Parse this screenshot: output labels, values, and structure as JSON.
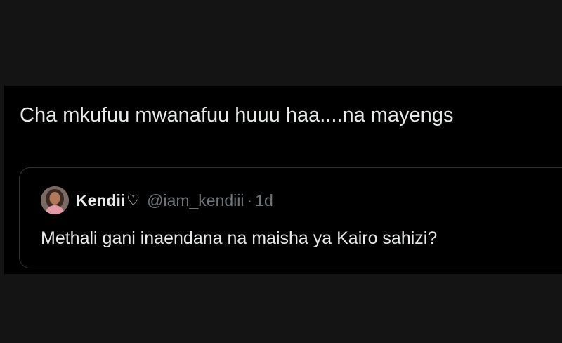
{
  "tweet": {
    "text": "Cha mkufuu mwanafuu huuu haa....na mayengs"
  },
  "quoted_tweet": {
    "display_name": "Kendii",
    "name_icon": "heart-outline-icon",
    "handle": "@iam_kendiii",
    "separator": "·",
    "time": "1d",
    "text": "Methali gani inaendana na maisha ya Kairo sahizi?"
  },
  "colors": {
    "background": "#141414",
    "card": "#000000",
    "primary_text": "#e7e9ea",
    "secondary_text": "#71767b",
    "border": "#2f3336"
  }
}
